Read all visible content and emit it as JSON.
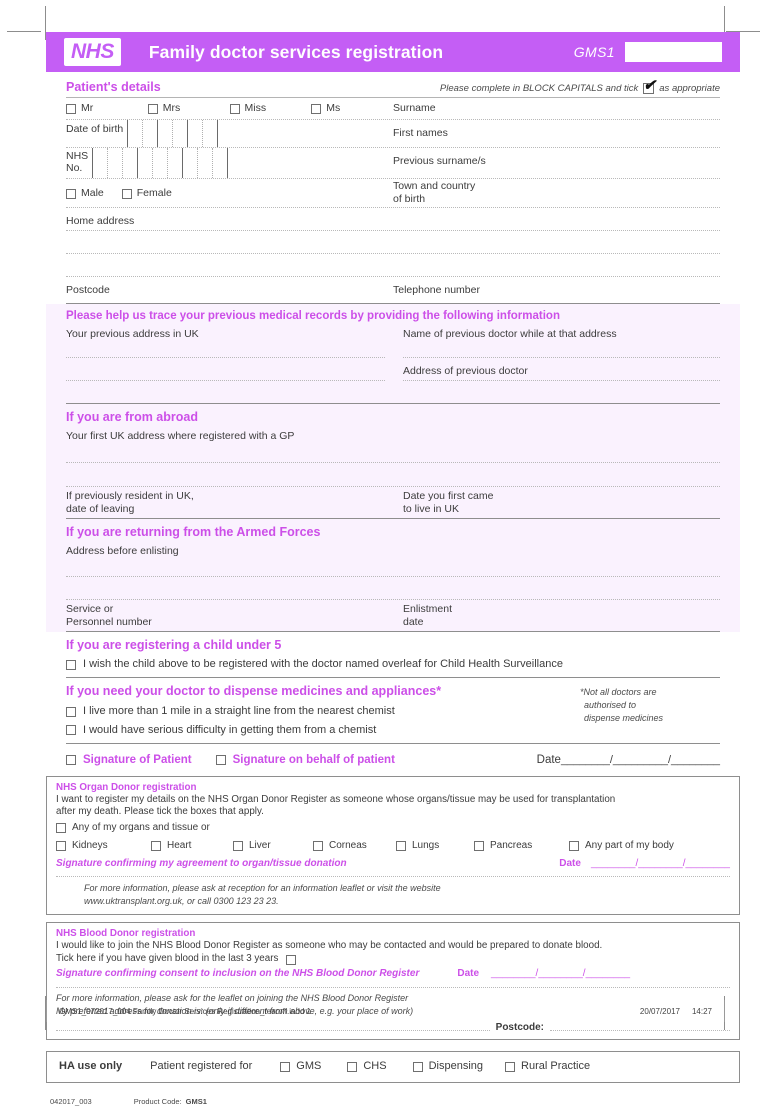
{
  "header": {
    "logo": "NHS",
    "title": "Family doctor services registration",
    "form_code": "GMS1",
    "accent_color": "#c45ef5"
  },
  "patient_details": {
    "heading": "Patient's details",
    "instruction_pre": "Please complete in BLOCK CAPITALS and tick",
    "instruction_post": "as appropriate",
    "titles": [
      "Mr",
      "Mrs",
      "Miss",
      "Ms"
    ],
    "surname_label": "Surname",
    "dob_label": "Date of birth",
    "first_names_label": "First names",
    "nhs_no_label_line1": "NHS",
    "nhs_no_label_line2": "No.",
    "previous_surnames_label": "Previous surname/s",
    "sex": [
      "Male",
      "Female"
    ],
    "town_country_line1": "Town and country",
    "town_country_line2": "of birth",
    "home_address_label": "Home address",
    "postcode_label": "Postcode",
    "telephone_label": "Telephone number"
  },
  "trace_records": {
    "heading": "Please help us trace your previous medical records by providing the following information",
    "previous_address_label": "Your previous address in UK",
    "previous_doctor_name_label": "Name of previous doctor while at that address",
    "previous_doctor_address_label": "Address of previous doctor"
  },
  "from_abroad": {
    "heading": "If you are from abroad",
    "first_uk_address_label": "Your first UK address where registered with a GP",
    "date_of_leaving_line1": "If previously resident in UK,",
    "date_of_leaving_line2": "date of leaving",
    "first_came_line1": "Date you first came",
    "first_came_line2": "to live in UK"
  },
  "armed_forces": {
    "heading": "If you are returning from the Armed Forces",
    "address_before_enlisting_label": "Address before enlisting",
    "service_number_line1": "Service or",
    "service_number_line2": "Personnel number",
    "enlistment_line1": "Enlistment",
    "enlistment_line2": "date"
  },
  "child_under_5": {
    "heading": "If you are registering a child under 5",
    "checkbox_label": "I wish the child above to be registered with the doctor named overleaf for Child Health Surveillance"
  },
  "dispensing": {
    "heading": "If you need your doctor to dispense medicines and appliances*",
    "note_line1": "*Not all doctors are",
    "note_line2": "authorised to",
    "note_line3": "dispense medicines",
    "options": [
      "I live more than 1 mile in a straight line from the nearest chemist",
      "I would have serious difficulty in getting them from a chemist"
    ]
  },
  "signature_row": {
    "signature_patient": "Signature of Patient",
    "signature_behalf": "Signature on behalf of patient",
    "date_label": "Date",
    "date_blanks": "________/_________/________"
  },
  "organ_donor": {
    "heading": "NHS Organ Donor registration",
    "body_line1": "I want to register my details on the NHS Organ Donor Register as someone whose organs/tissue may be used for transplantation",
    "body_line2": "after my death. Please tick the boxes that apply.",
    "any_organs_label": "Any of my organs and tissue or",
    "organs": [
      "Kidneys",
      "Heart",
      "Liver",
      "Corneas",
      "Lungs",
      "Pancreas",
      "Any part of my body"
    ],
    "signature_label": "Signature confirming my agreement to organ/tissue donation",
    "date_label": "Date",
    "date_blanks": "________/________/________",
    "info_line1": "For more information, please ask at reception for an information leaflet or visit the website",
    "info_line2": "www.uktransplant.org.uk, or call 0300 123 23 23."
  },
  "blood_donor": {
    "heading": "NHS Blood Donor registration",
    "body_line1": "I would like to join the NHS Blood Donor Register as someone who may be contacted and would be prepared to donate blood.",
    "tick_label": "Tick here if you have given blood in the last 3 years",
    "signature_label": "Signature confirming consent to inclusion on the NHS Blood Donor Register",
    "date_label": "Date",
    "date_blanks": "________/________/________",
    "info_line1": "For more information, please ask for the leaflet on joining the NHS Blood Donor Register",
    "info_line2": "My preferred address for donation is: (only if different from above, e.g. your place of work)",
    "postcode_label": "Postcode:"
  },
  "ha_use": {
    "heading": "HA use only",
    "registered_for_label": "Patient registered for",
    "options": [
      "GMS",
      "CHS",
      "Dispensing",
      "Rural Practice"
    ]
  },
  "print_info": {
    "revision": "042017_003",
    "product_code_label": "Product Code:",
    "product_code": "GMS1"
  },
  "footer": {
    "filename": "GMS1_072017_004 Family Doctor Services Registration_tearoff.indd   1",
    "date": "20/07/2017",
    "time": "14:27"
  }
}
